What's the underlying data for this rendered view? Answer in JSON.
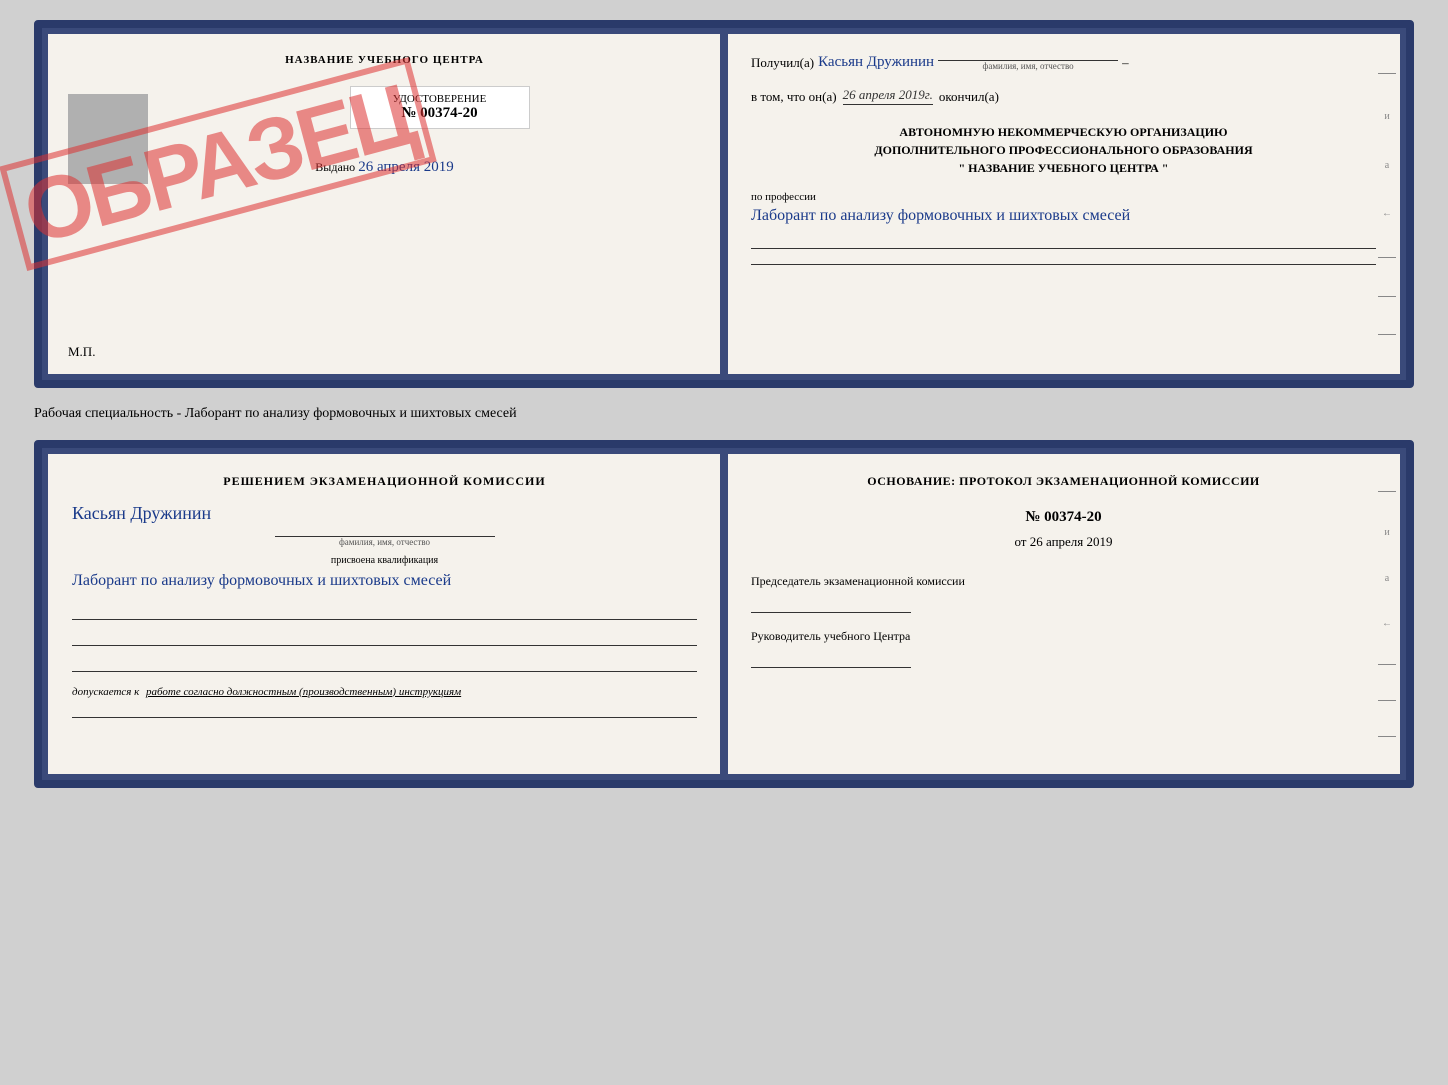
{
  "top_book": {
    "left_page": {
      "title": "НАЗВАНИЕ УЧЕБНОГО ЦЕНТРА",
      "cert_label": "УДОСТОВЕРЕНИЕ",
      "cert_number": "№ 00374-20",
      "issued_label": "Выдано",
      "issued_date": "26 апреля 2019",
      "mp_label": "М.П.",
      "stamp_text": "ОБРАЗЕЦ"
    },
    "right_page": {
      "recipient_prefix": "Получил(а)",
      "recipient_name": "Касьян Дружинин",
      "recipient_sub": "фамилия, имя, отчество",
      "dash": "–",
      "date_prefix": "в том, что он(а)",
      "date_value": "26 апреля 2019г.",
      "date_suffix": "окончил(а)",
      "org_line1": "АВТОНОМНУЮ НЕКОММЕРЧЕСКУЮ ОРГАНИЗАЦИЮ",
      "org_line2": "ДОПОЛНИТЕЛЬНОГО ПРОФЕССИОНАЛЬНОГО ОБРАЗОВАНИЯ",
      "org_line3": "\"  НАЗВАНИЕ УЧЕБНОГО ЦЕНТРА  \"",
      "profession_label": "по профессии",
      "profession_text": "Лаборант по анализу формовочных и шихтовых смесей",
      "side_letters": [
        "и",
        "а",
        "←",
        "–",
        "–",
        "–"
      ]
    }
  },
  "specialty_line": "Рабочая специальность - Лаборант по анализу формовочных и шихтовых смесей",
  "bottom_book": {
    "left_page": {
      "decision_title": "Решением экзаменационной комиссии",
      "name": "Касьян Дружинин",
      "name_sub": "фамилия, имя, отчество",
      "qualification_prefix": "присвоена квалификация",
      "qualification_text": "Лаборант по анализу формовочных и шихтовых смесей",
      "allowed_prefix": "допускается к",
      "allowed_text": "работе согласно должностным (производственным) инструкциям"
    },
    "right_page": {
      "basis_title": "Основание: протокол экзаменационной комиссии",
      "protocol_number": "№  00374-20",
      "protocol_date_prefix": "от",
      "protocol_date": "26 апреля 2019",
      "chairman_label": "Председатель экзаменационной комиссии",
      "director_label": "Руководитель учебного Центра",
      "side_letters": [
        "и",
        "а",
        "←",
        "–",
        "–",
        "–"
      ]
    }
  }
}
